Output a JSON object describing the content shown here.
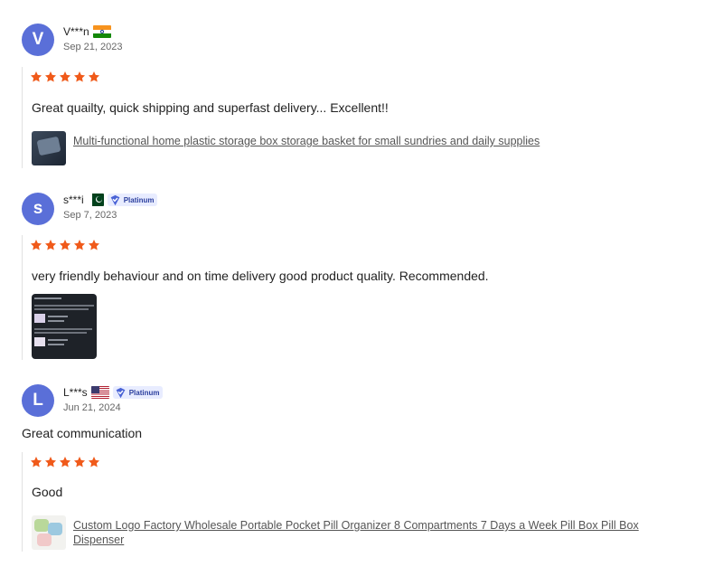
{
  "reviews": [
    {
      "avatar_letter": "V",
      "name": "V***n",
      "flag": "india-flag",
      "date": "Sep 21, 2023",
      "rating": 5,
      "comment": "Great quailty, quick shipping and superfast delivery... Excellent!!",
      "product": "Multi-functional home plastic storage box storage basket for small sundries and daily supplies"
    },
    {
      "avatar_letter": "s",
      "name": "s***i",
      "flag": "pakistan-flag",
      "badge": "Platinum",
      "date": "Sep 7, 2023",
      "rating": 5,
      "comment": "very friendly behaviour and on time delivery good product quality. Recommended."
    },
    {
      "avatar_letter": "L",
      "name": "L***s",
      "flag": "usa-flag",
      "badge": "Platinum",
      "date": "Jun 21, 2024",
      "headline": "Great communication",
      "rating": 5,
      "comment": "Good",
      "product": "Custom Logo Factory Wholesale Portable Pocket Pill Organizer 8 Compartments 7 Days a Week Pill Box Pill Box Dispenser"
    }
  ],
  "colors": {
    "avatar": "#5a6fd8",
    "star": "#f05a1a",
    "badge_bg": "#e8ecff",
    "badge_text": "#2b3f9e"
  }
}
